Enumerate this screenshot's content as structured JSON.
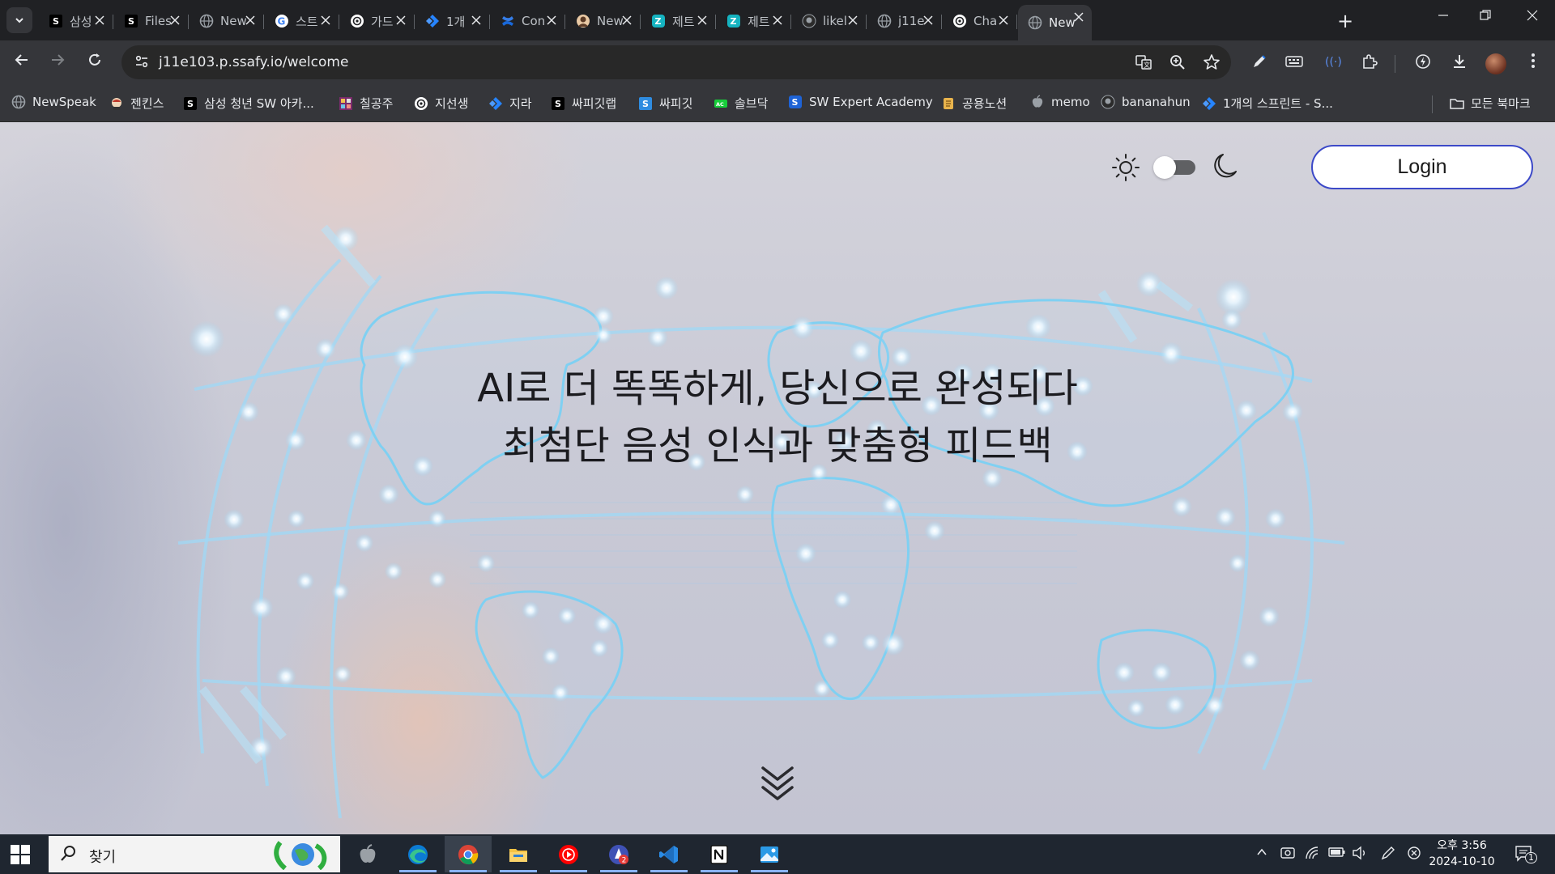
{
  "browser": {
    "tabs": [
      {
        "label": "삼성",
        "icon": "ssafy-favicon",
        "color": "#000000"
      },
      {
        "label": "Files",
        "icon": "ssafy-favicon",
        "color": "#000000"
      },
      {
        "label": "New",
        "icon": "globe-favicon",
        "color": "#5f6368"
      },
      {
        "label": "스트",
        "icon": "google-favicon",
        "color": "#ffffff"
      },
      {
        "label": "가드",
        "icon": "openai-favicon",
        "color": "#ffffff"
      },
      {
        "label": "1개",
        "icon": "jira-favicon",
        "color": "#2684ff"
      },
      {
        "label": "Con",
        "icon": "confluence-favicon",
        "color": "#1868db"
      },
      {
        "label": "New",
        "icon": "avatar-favicon",
        "color": "#c9a27e"
      },
      {
        "label": "제트",
        "icon": "zetpeak-favicon",
        "color": "#15b3c0"
      },
      {
        "label": "제트",
        "icon": "zetpeak-favicon",
        "color": "#15b3c0"
      },
      {
        "label": "likel",
        "icon": "github-favicon",
        "color": "#202124"
      },
      {
        "label": "j11e",
        "icon": "globe-favicon",
        "color": "#5f6368"
      },
      {
        "label": "Cha",
        "icon": "openai-favicon",
        "color": "#ffffff"
      },
      {
        "label": "New",
        "icon": "globe-favicon",
        "color": "#5f6368",
        "active": true
      }
    ],
    "new_tab_label": "+",
    "url": "j11e103.p.ssafy.io/welcome",
    "bookmarks": [
      {
        "label": "NewSpeak",
        "icon": "globe-favicon"
      },
      {
        "label": "젠킨스",
        "icon": "jenkins-favicon"
      },
      {
        "label": "삼성 청년 SW 아카...",
        "icon": "ssafy-favicon"
      },
      {
        "label": "칠공주",
        "icon": "grid-favicon"
      },
      {
        "label": "지선생",
        "icon": "openai-favicon"
      },
      {
        "label": "지라",
        "icon": "jira-favicon"
      },
      {
        "label": "싸피깃랩",
        "icon": "ssafy-favicon"
      },
      {
        "label": "싸피깃",
        "icon": "ssafy-blue-favicon"
      },
      {
        "label": "솔브닥",
        "icon": "solvedac-favicon"
      },
      {
        "label": "SW Expert Academy",
        "icon": "swea-favicon"
      },
      {
        "label": "공용노션",
        "icon": "scroll-favicon"
      },
      {
        "label": "memo",
        "icon": "apple-favicon"
      },
      {
        "label": "bananahun",
        "icon": "github-favicon"
      },
      {
        "label": "1개의 스프린트 - S...",
        "icon": "jira-favicon"
      }
    ],
    "all_bookmarks_label": "모든 북마크"
  },
  "page": {
    "login_label": "Login",
    "headline_1": "AI로 더 똑똑하게, 당신으로 완성되다",
    "headline_2": "최첨단 음성 인식과 맞춤형 피드백",
    "theme_toggle_state": "light"
  },
  "taskbar": {
    "search_placeholder": "찾기",
    "apps": [
      "apple-app",
      "edge-app",
      "chrome-app",
      "file-explorer-app",
      "youtube-music-app",
      "cleaner-app",
      "vscode-app",
      "notion-app",
      "photos-app"
    ],
    "active_app": "chrome-app",
    "cleaner_badge": "2",
    "clock_time": "오후 3:56",
    "clock_date": "2024-10-10",
    "notification_count": "1"
  },
  "colors": {
    "login_border": "#3c49c8",
    "map_glow": "#8fd3f4",
    "headline": "#1b1b1f"
  }
}
